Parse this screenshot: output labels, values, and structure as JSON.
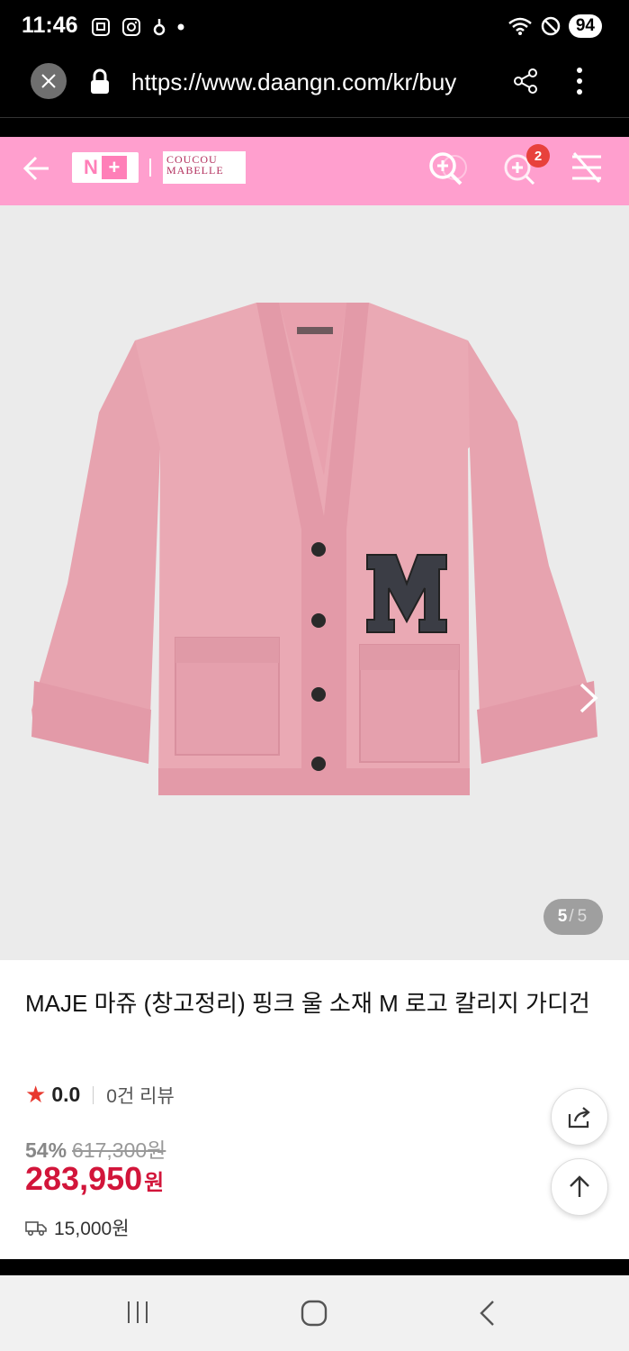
{
  "status_bar": {
    "time": "11:46",
    "battery": "94",
    "left_icons": [
      "screenshot-icon",
      "instagram-icon",
      "app-icon",
      "dot-icon"
    ],
    "right_icons": [
      "wifi-icon",
      "do-not-disturb-icon"
    ]
  },
  "browser": {
    "url": "https://www.daangn.com/kr/buy"
  },
  "header": {
    "logo_n": "N",
    "logo_plus": "+",
    "brand_line1": "COUCOU",
    "brand_line2": "MABELLE",
    "cart_count": "2"
  },
  "product": {
    "image_counter_current": "5",
    "image_counter_sep": "/",
    "image_counter_total": "5",
    "title": "MAJE 마쥬 (창고정리) 핑크 울 소재 M 로고 칼리지 가디건",
    "rating": "0.0",
    "review_count": "0건 리뷰",
    "discount_percent": "54%",
    "original_price": "617,300원",
    "price": "283,950",
    "price_unit": "원",
    "shipping_fee": "15,000원"
  },
  "colors": {
    "header_pink": "#ff9fce",
    "price_red": "#d2153a",
    "star_red": "#e8382e",
    "cardigan_pink": "#eaa9b4"
  }
}
